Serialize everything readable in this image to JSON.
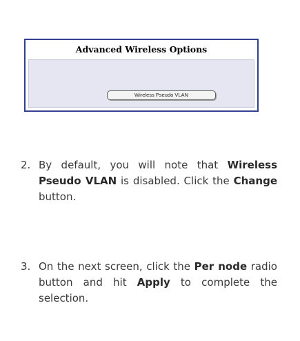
{
  "panel": {
    "title": "Advanced Wireless Options",
    "button_label": "Wireless Pseudo VLAN"
  },
  "steps": [
    {
      "number": "2.",
      "parts": [
        "By default, you will note that ",
        "Wireless Pseudo VLAN",
        " is disabled. Click the ",
        "Change",
        " button."
      ]
    },
    {
      "number": "3.",
      "parts": [
        "On the next screen, click the ",
        "Per node",
        " radio button and hit ",
        "Apply",
        " to complete the selection."
      ]
    }
  ],
  "colors": {
    "panel_border": "#2f3f8f",
    "panel_fill": "#e6e6f2",
    "text": "#3a3a3a"
  }
}
